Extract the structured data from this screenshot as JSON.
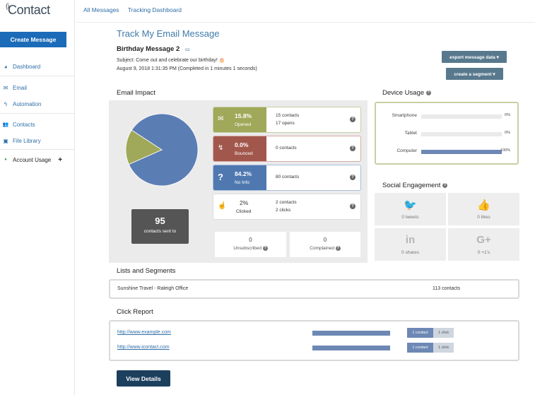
{
  "brand": {
    "logo_prefix": "(i",
    "logo_text": "Contact"
  },
  "sidebar": {
    "create_label": "Create Message",
    "items": [
      {
        "icon": "speedometer-icon",
        "glyph": "◕",
        "label": "Dashboard"
      },
      {
        "icon": "envelope-icon",
        "glyph": "✉",
        "label": "Email"
      },
      {
        "icon": "lightning-icon",
        "glyph": "ϟ",
        "label": "Automation"
      },
      {
        "icon": "users-icon",
        "glyph": "👥",
        "label": "Contacts"
      },
      {
        "icon": "image-icon",
        "glyph": "▣",
        "label": "File Library"
      },
      {
        "icon": "status-dot-icon",
        "glyph": "●",
        "label": "Account Usage",
        "extra": "+"
      }
    ]
  },
  "topnav": {
    "all_messages": "All Messages",
    "tracking": "Tracking Dashboard"
  },
  "page": {
    "title": "Track My Email Message",
    "message_name": "Birthday Message 2",
    "subject": "Subject: Come out and celebrate our birthday! 🎂",
    "sent_info": "August 9, 2018 1:31:35 PM (Completed in 1 minutes 1 seconds)",
    "export_label": "export message data ▾",
    "segment_label": "create a segment ▾"
  },
  "impact": {
    "heading": "Email Impact",
    "pie": [
      {
        "value": 84.2,
        "color": "#5a7db4"
      },
      {
        "value": 15.8,
        "color": "#a0a859"
      }
    ],
    "sent_count": "95",
    "sent_label": "contacts sent to",
    "metrics": [
      {
        "pct": "15.8%",
        "name": "Opened",
        "color": "#a0a859",
        "border": "#c8cfa4",
        "icon": "inbox-icon",
        "glyph": "✉",
        "line1": "15 contacts",
        "line2": "17 opens"
      },
      {
        "pct": "0.0%",
        "name": "Bounced",
        "color": "#a2574d",
        "border": "#d8aaa4",
        "icon": "bounce-icon",
        "glyph": "↯",
        "line1": "0 contacts",
        "line2": ""
      },
      {
        "pct": "84.2%",
        "name": "No Info",
        "color": "#4f78b0",
        "border": "#a9bedb",
        "icon": "question-icon",
        "glyph": "?",
        "line1": "80 contacts",
        "line2": ""
      },
      {
        "pct": "2%",
        "name": "Clicked",
        "color": "#ffffff",
        "border": "#dddddd",
        "icon": "pointer-hand-icon",
        "glyph": "☝",
        "line1": "2 contacts",
        "line2": "2 clicks"
      }
    ],
    "unsubscribed": {
      "count": "0",
      "label": "Unsubscribed"
    },
    "complained": {
      "count": "0",
      "label": "Complained"
    }
  },
  "device": {
    "heading": "Device Usage",
    "rows": [
      {
        "label": "Smartphone",
        "pct": "0%",
        "value": 0
      },
      {
        "label": "Tablet",
        "pct": "0%",
        "value": 0
      },
      {
        "label": "Computer",
        "pct": "100%",
        "value": 100
      }
    ]
  },
  "social": {
    "heading": "Social Engagement",
    "items": [
      {
        "icon": "twitter-icon",
        "glyph": "🐦",
        "label": "0 tweets"
      },
      {
        "icon": "thumbs-up-icon",
        "glyph": "👍",
        "label": "0 likes"
      },
      {
        "icon": "linkedin-icon",
        "glyph": "in",
        "label": "0 shares"
      },
      {
        "icon": "google-plus-icon",
        "glyph": "G+",
        "label": "0 +1's"
      }
    ]
  },
  "lists": {
    "heading": "Lists and Segments",
    "name": "Sunshine Travel - Raleigh Office",
    "count": "113 contacts"
  },
  "clicks": {
    "heading": "Click Report",
    "rows": [
      {
        "url": "http://www.example.com",
        "contact": "1 contact",
        "click": "1 click",
        "share": 1
      },
      {
        "url": "http://www.icontact.com",
        "contact": "1 contact",
        "click": "1 click",
        "share": 1
      }
    ]
  },
  "view_details": "View Details"
}
